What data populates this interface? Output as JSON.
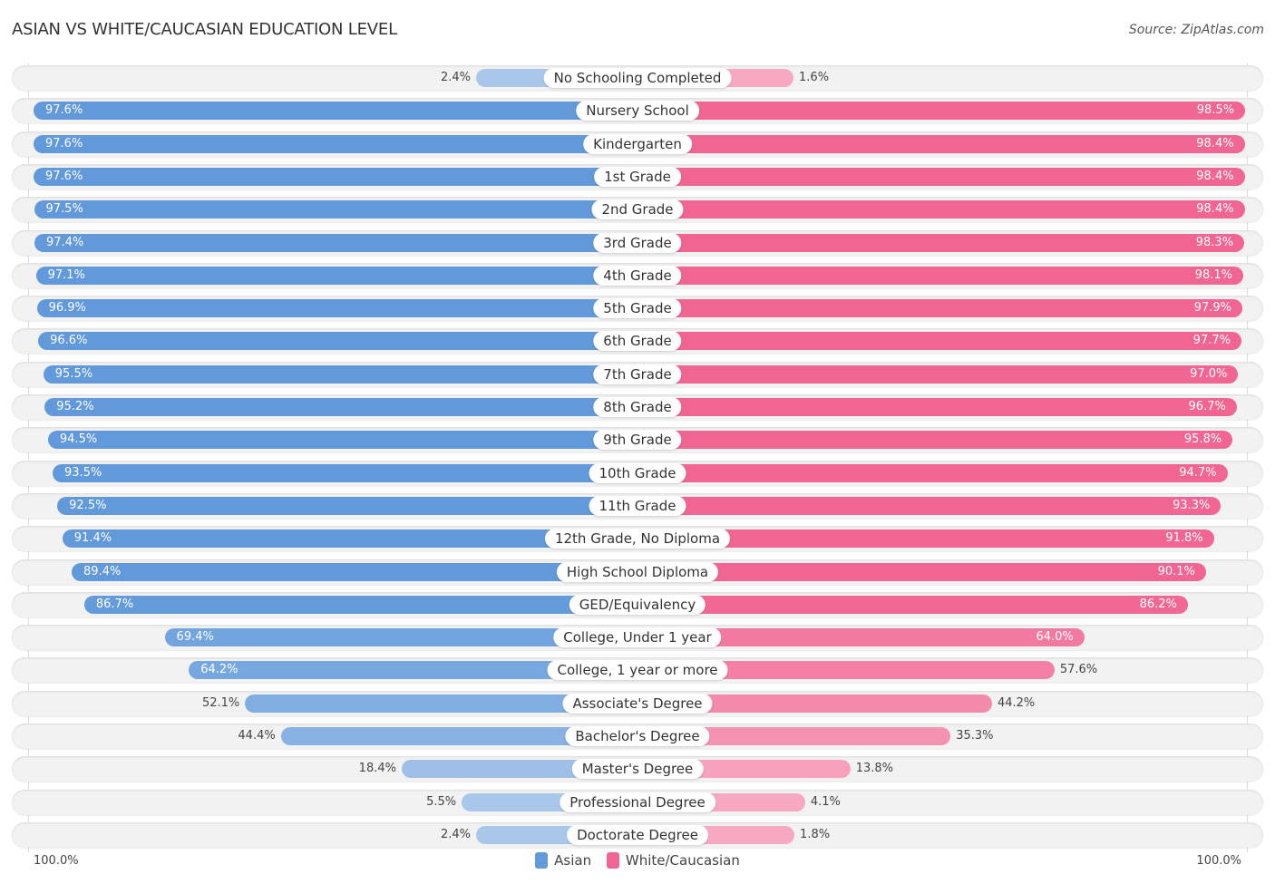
{
  "header": {
    "title": "ASIAN VS WHITE/CAUCASIAN EDUCATION LEVEL",
    "source": "Source: ZipAtlas.com"
  },
  "colors": {
    "asian_strong": "#6199da",
    "asian_light": "#a9c7ea",
    "white_strong": "#f06591",
    "white_light": "#f7a9c2"
  },
  "chart_data": {
    "type": "bar",
    "orientation": "horizontal-diverging",
    "title": "ASIAN VS WHITE/CAUCASIAN EDUCATION LEVEL",
    "xlabel": "",
    "ylabel": "",
    "xlim": [
      0,
      100
    ],
    "axis_left_label": "100.0%",
    "axis_right_label": "100.0%",
    "legend_position": "bottom-center",
    "categories": [
      "No Schooling Completed",
      "Nursery School",
      "Kindergarten",
      "1st Grade",
      "2nd Grade",
      "3rd Grade",
      "4th Grade",
      "5th Grade",
      "6th Grade",
      "7th Grade",
      "8th Grade",
      "9th Grade",
      "10th Grade",
      "11th Grade",
      "12th Grade, No Diploma",
      "High School Diploma",
      "GED/Equivalency",
      "College, Under 1 year",
      "College, 1 year or more",
      "Associate's Degree",
      "Bachelor's Degree",
      "Master's Degree",
      "Professional Degree",
      "Doctorate Degree"
    ],
    "series": [
      {
        "name": "Asian",
        "side": "left",
        "values": [
          2.4,
          97.6,
          97.6,
          97.6,
          97.5,
          97.4,
          97.1,
          96.9,
          96.6,
          95.5,
          95.2,
          94.5,
          93.5,
          92.5,
          91.4,
          89.4,
          86.7,
          69.4,
          64.2,
          52.1,
          44.4,
          18.4,
          5.5,
          2.4
        ],
        "labels": [
          "2.4%",
          "97.6%",
          "97.6%",
          "97.6%",
          "97.5%",
          "97.4%",
          "97.1%",
          "96.9%",
          "96.6%",
          "95.5%",
          "95.2%",
          "94.5%",
          "93.5%",
          "92.5%",
          "91.4%",
          "89.4%",
          "86.7%",
          "69.4%",
          "64.2%",
          "52.1%",
          "44.4%",
          "18.4%",
          "5.5%",
          "2.4%"
        ]
      },
      {
        "name": "White/Caucasian",
        "side": "right",
        "values": [
          1.6,
          98.5,
          98.4,
          98.4,
          98.4,
          98.3,
          98.1,
          97.9,
          97.7,
          97.0,
          96.7,
          95.8,
          94.7,
          93.3,
          91.8,
          90.1,
          86.2,
          64.0,
          57.6,
          44.2,
          35.3,
          13.8,
          4.1,
          1.8
        ],
        "labels": [
          "1.6%",
          "98.5%",
          "98.4%",
          "98.4%",
          "98.4%",
          "98.3%",
          "98.1%",
          "97.9%",
          "97.7%",
          "97.0%",
          "96.7%",
          "95.8%",
          "94.7%",
          "93.3%",
          "91.8%",
          "90.1%",
          "86.2%",
          "64.0%",
          "57.6%",
          "44.2%",
          "35.3%",
          "13.8%",
          "4.1%",
          "1.8%"
        ]
      }
    ]
  },
  "legend": {
    "items": [
      {
        "label": "Asian"
      },
      {
        "label": "White/Caucasian"
      }
    ]
  }
}
